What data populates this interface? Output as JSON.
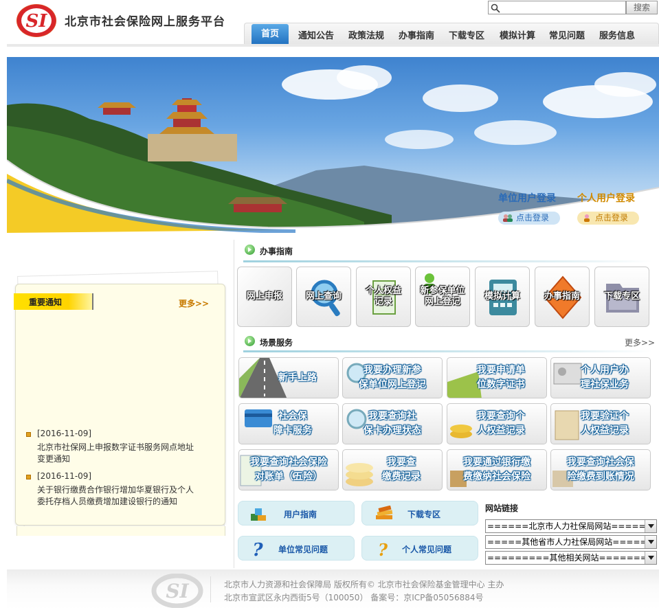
{
  "header": {
    "site_title": "北京市社会保险网上服务平台",
    "logo_text": "SI",
    "search": {
      "placeholder": "",
      "button_label": "搜索"
    },
    "nav": [
      {
        "label": "首页",
        "active": true
      },
      {
        "label": "通知公告"
      },
      {
        "label": "政策法规"
      },
      {
        "label": "办事指南"
      },
      {
        "label": "下载专区"
      },
      {
        "label": "模拟计算"
      },
      {
        "label": "常见问题"
      },
      {
        "label": "服务信息"
      }
    ]
  },
  "banner": {
    "unit_login": {
      "label": "单位用户登录",
      "button": "点击登录"
    },
    "personal_login": {
      "label": "个人用户登录",
      "button": "点击登录"
    }
  },
  "notice": {
    "title": "重要通知",
    "more": "更多>>",
    "items": [
      {
        "date": "[2016-11-09]",
        "text_line1": "北京市社保网上申报数字证书服务网点地址",
        "text_line2": "变更通知"
      },
      {
        "date": "[2016-11-09]",
        "text_line1": "关于银行缴费合作银行增加华夏银行及个人",
        "text_line2": "委托存档人员缴费增加建设银行的通知"
      }
    ]
  },
  "guide": {
    "title": "办事指南",
    "tiles": [
      {
        "line1": "网上申报",
        "line2": ""
      },
      {
        "line1": "网上查询",
        "line2": ""
      },
      {
        "line1": "个人权益",
        "line2": "记录"
      },
      {
        "line1": "新参保单位",
        "line2": "网上登记"
      },
      {
        "line1": "模拟计算",
        "line2": ""
      },
      {
        "line1": "办事指南",
        "line2": ""
      },
      {
        "line1": "下载专区",
        "line2": ""
      }
    ]
  },
  "scenes": {
    "title": "场景服务",
    "more": "更多>>",
    "items": [
      {
        "line1": "新手上路",
        "line2": ""
      },
      {
        "line1": "我要办理新参",
        "line2": "保单位网上登记"
      },
      {
        "line1": "我要申请单",
        "line2": "位数字证书"
      },
      {
        "line1": "个人用户办",
        "line2": "理社保业务"
      },
      {
        "line1": "社会保",
        "line2": "障卡服务"
      },
      {
        "line1": "我要查询社",
        "line2": "保卡办理状态"
      },
      {
        "line1": "我要查询个",
        "line2": "人权益记录"
      },
      {
        "line1": "我要验证个",
        "line2": "人权益记录"
      },
      {
        "line1": "我要查询社会保险",
        "line2": "对账单（五险）"
      },
      {
        "line1": "我要查",
        "line2": "缴费记录"
      },
      {
        "line1": "我要通过银行缴",
        "line2": "费缴纳社会保险"
      },
      {
        "line1": "我要查询社会保",
        "line2": "险缴费到账情况"
      }
    ]
  },
  "quick_links": [
    {
      "label": "用户指南",
      "icon": "user-guide-icon"
    },
    {
      "label": "下载专区",
      "icon": "download-books-icon"
    },
    {
      "label": "单位常见问题",
      "icon": "question-icon"
    },
    {
      "label": "个人常见问题",
      "icon": "question-icon"
    }
  ],
  "site_links": {
    "title": "网站链接",
    "selects": [
      "======北京市人力社保局网站======",
      "=====其他省市人力社保局网站=====",
      "=========其他相关网站========="
    ]
  },
  "footer": {
    "line1": "北京市人力资源和社会保障局 版权所有© 北京市社会保险基金管理中心 主办",
    "line2": "北京市宣武区永内西街5号（100050） 备案号：京ICP备05056884号"
  },
  "colors": {
    "nav_active": "#2f82d1",
    "notice_tab": "#ffde00",
    "link_blue": "#1a58a8",
    "logo_red": "#d42222"
  }
}
